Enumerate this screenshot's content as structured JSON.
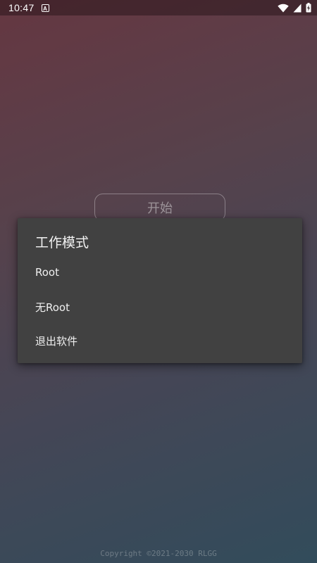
{
  "status_bar": {
    "time": "10:47",
    "notification_glyph": "A",
    "icons": [
      "wifi-icon",
      "signal-icon",
      "battery-charging-icon"
    ]
  },
  "main": {
    "start_button_label": "开始",
    "copyright": "Copyright ©2021-2030 RLGG"
  },
  "dialog": {
    "title": "工作模式",
    "items": [
      {
        "label": "Root"
      },
      {
        "label": "无Root"
      },
      {
        "label": "退出软件"
      }
    ]
  },
  "colors": {
    "dialog_background": "#414141",
    "gradient_top": "#6a3a44",
    "gradient_bottom": "#35505f"
  }
}
